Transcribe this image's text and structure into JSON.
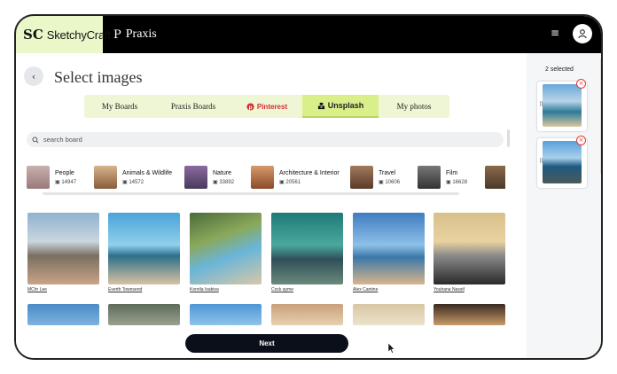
{
  "topbar": {
    "sketchycraft_mark": "SC",
    "sketchycraft_name": "SketchyCraft",
    "praxis_mark": "P",
    "praxis_name": "Praxis",
    "menu_icon": "hamburger-icon",
    "avatar_icon": "user-icon"
  },
  "page": {
    "title": "Select images",
    "back_icon": "chevron-left-icon"
  },
  "tabs": [
    {
      "label": "My Boards"
    },
    {
      "label": "Praxis Boards"
    },
    {
      "label": "Pinterest"
    },
    {
      "label": "Unsplash"
    },
    {
      "label": "My photos"
    }
  ],
  "search": {
    "placeholder": "search board"
  },
  "categories": [
    {
      "name": "People",
      "count": "14947",
      "color": "#b79b9b"
    },
    {
      "name": "Animals & Wildlife",
      "count": "14572",
      "color": "#a57c5c"
    },
    {
      "name": "Nature",
      "count": "33892",
      "color": "#7a5a8a"
    },
    {
      "name": "Architecture & Interior",
      "count": "20561",
      "color": "#b0704a"
    },
    {
      "name": "Travel",
      "count": "10606",
      "color": "#8a6a4a"
    },
    {
      "name": "Film",
      "count": "16628",
      "color": "#555555"
    }
  ],
  "photos": [
    {
      "credit": "MChr Lee",
      "bg": "linear-gradient(180deg,#8fb2cf 0%,#c9d6df 40%,#7a6f61 60%,#c9a487 100%)"
    },
    {
      "credit": "Everth Townsend",
      "bg": "linear-gradient(180deg,#4aa3d8 0%,#8fd0ec 45%,#2d6f8a 60%,#d8c2a3 100%)"
    },
    {
      "credit": "Konrila Isabiva",
      "bg": "linear-gradient(160deg,#4a6b3a 0%,#8aa85a 35%,#6ab5d8 60%,#d8c8a8 100%)"
    },
    {
      "credit": "Cock ayme",
      "bg": "linear-gradient(180deg,#1e7a78 0%,#4aa89e 45%,#2f4f5a 65%,#6a8a7a 100%)"
    },
    {
      "credit": "Alex Cantine",
      "bg": "linear-gradient(180deg,#3f7cc0 0%,#8ec0e8 45%,#3a78a8 62%,#d9b48c 100%)"
    },
    {
      "credit": "Youhana Nassif",
      "bg": "linear-gradient(180deg,#d8c08a 0%,#e8d2a0 40%,#8a8a8a 60%,#2a2a2a 100%)"
    },
    {
      "credit": "",
      "bg": "linear-gradient(180deg,#4a8bc8 0%,#7fb2de 100%)"
    },
    {
      "credit": "",
      "bg": "linear-gradient(180deg,#5e6a5a 0%,#9aa28e 100%)"
    },
    {
      "credit": "",
      "bg": "linear-gradient(180deg,#4e96d6 0%,#8fc3ea 100%)"
    },
    {
      "credit": "",
      "bg": "linear-gradient(180deg,#c9a07a 0%,#e8d0b0 100%)"
    },
    {
      "credit": "",
      "bg": "linear-gradient(180deg,#d8c7a5 0%,#ece2cc 100%)"
    },
    {
      "credit": "",
      "bg": "linear-gradient(180deg,#3a2a20 0%,#c89a6a 100%)"
    }
  ],
  "next_label": "Next",
  "sidebar": {
    "selected_text": "2 selected",
    "items": [
      {
        "bg": "linear-gradient(180deg,#6aa8d8 0%,#b8d4e8 40%,#2d7a9a 65%,#d8c8a0 100%)",
        "remove_icon": "close-icon"
      },
      {
        "bg": "linear-gradient(180deg,#5aa0d8 0%,#a8d0ec 40%,#1f5a80 60%,#4a5a5a 100%)",
        "remove_icon": "close-icon"
      }
    ]
  }
}
